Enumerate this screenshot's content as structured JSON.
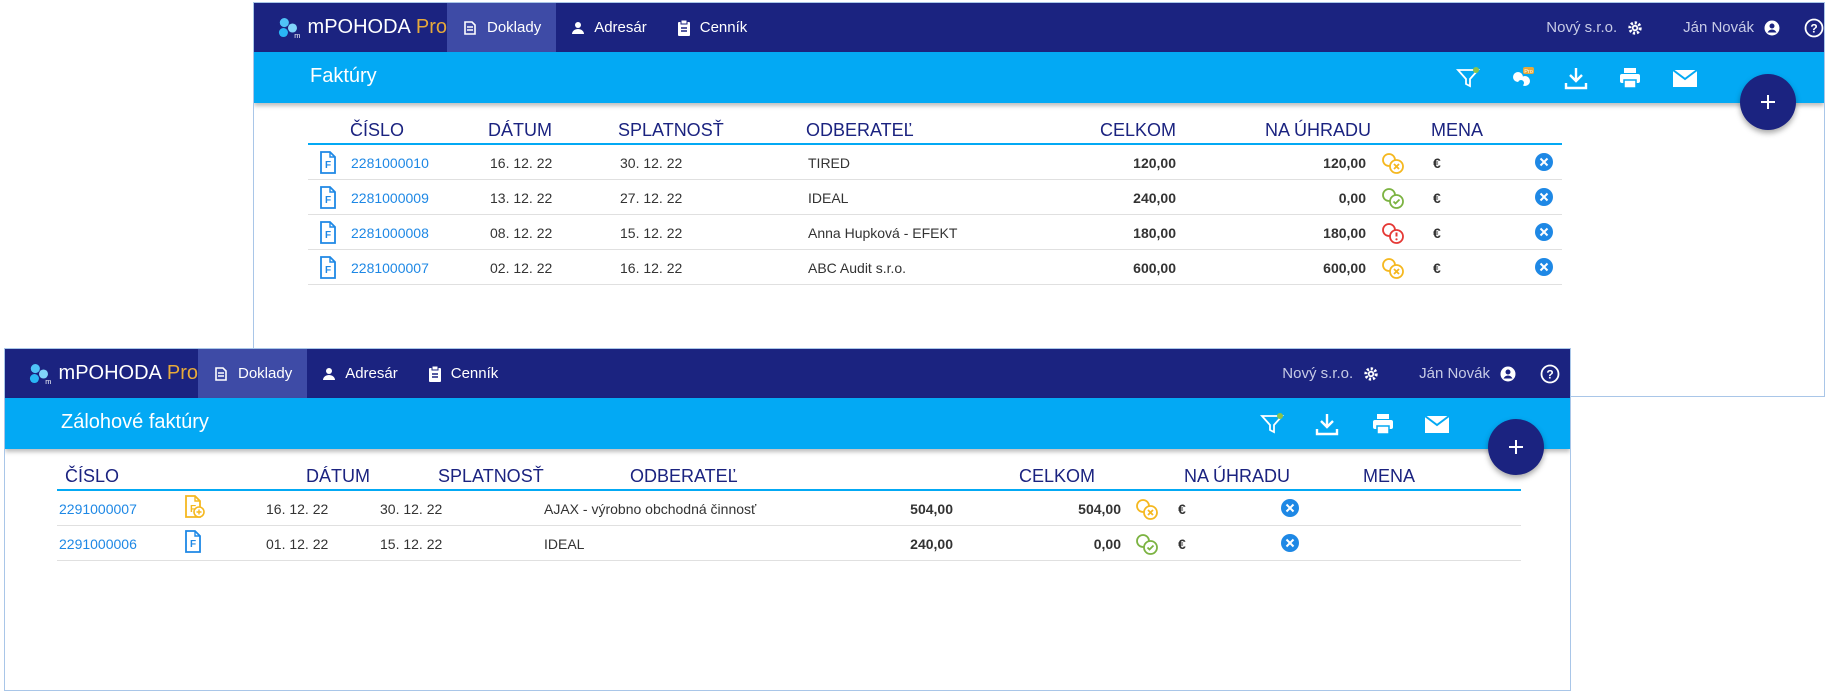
{
  "colors": {
    "navbar": "#1b2380",
    "subbar": "#03a9f4",
    "link": "#1e88e5",
    "pro": "#e6a93a",
    "status_partial": "#f5b820",
    "status_paid": "#7cb342",
    "status_overdue": "#e53935"
  },
  "nav": {
    "brand": "mPOHODA",
    "pro": "Pro",
    "items": [
      {
        "label": "Doklady",
        "icon": "documents-icon"
      },
      {
        "label": "Adresár",
        "icon": "person-icon"
      },
      {
        "label": "Cenník",
        "icon": "clipboard-icon"
      }
    ],
    "company": "Nový s.r.o.",
    "user": "Ján Novák"
  },
  "win1": {
    "title": "Faktúry",
    "toolbar_icons": [
      "filter-icon",
      "pro-sync-icon",
      "download-icon",
      "print-icon",
      "mail-icon"
    ],
    "pro_badge": "Pro",
    "columns": [
      "ČÍSLO",
      "DÁTUM",
      "SPLATNOSŤ",
      "ODBERATEĽ",
      "CELKOM",
      "NA ÚHRADU",
      "MENA"
    ],
    "rows": [
      {
        "number": "2281000010",
        "date": "16. 12. 22",
        "due": "30. 12. 22",
        "customer": "TIRED",
        "total": "120,00",
        "to_pay": "120,00",
        "status": "partial",
        "currency": "€"
      },
      {
        "number": "2281000009",
        "date": "13. 12. 22",
        "due": "27. 12. 22",
        "customer": "IDEAL",
        "total": "240,00",
        "to_pay": "0,00",
        "status": "paid",
        "currency": "€"
      },
      {
        "number": "2281000008",
        "date": "08. 12. 22",
        "due": "15. 12. 22",
        "customer": "Anna Hupková - EFEKT",
        "total": "180,00",
        "to_pay": "180,00",
        "status": "overdue",
        "currency": "€"
      },
      {
        "number": "2281000007",
        "date": "02. 12. 22",
        "due": "16. 12. 22",
        "customer": "ABC Audit s.r.o.",
        "total": "600,00",
        "to_pay": "600,00",
        "status": "partial",
        "currency": "€"
      }
    ]
  },
  "win2": {
    "title": "Zálohové faktúry",
    "toolbar_icons": [
      "filter-icon",
      "download-icon",
      "print-icon",
      "mail-icon"
    ],
    "columns": [
      "ČÍSLO",
      "DÁTUM",
      "SPLATNOSŤ",
      "ODBERATEĽ",
      "CELKOM",
      "NA ÚHRADU",
      "MENA"
    ],
    "rows": [
      {
        "number": "2291000007",
        "doc_icon": "advance-invoice-pending-icon",
        "date": "16. 12. 22",
        "due": "30. 12. 22",
        "customer": "AJAX - výrobno obchodná činnosť",
        "total": "504,00",
        "to_pay": "504,00",
        "status": "partial",
        "currency": "€"
      },
      {
        "number": "2291000006",
        "doc_icon": "invoice-document-icon",
        "date": "01. 12. 22",
        "due": "15. 12. 22",
        "customer": "IDEAL",
        "total": "240,00",
        "to_pay": "0,00",
        "status": "paid",
        "currency": "€"
      }
    ]
  }
}
